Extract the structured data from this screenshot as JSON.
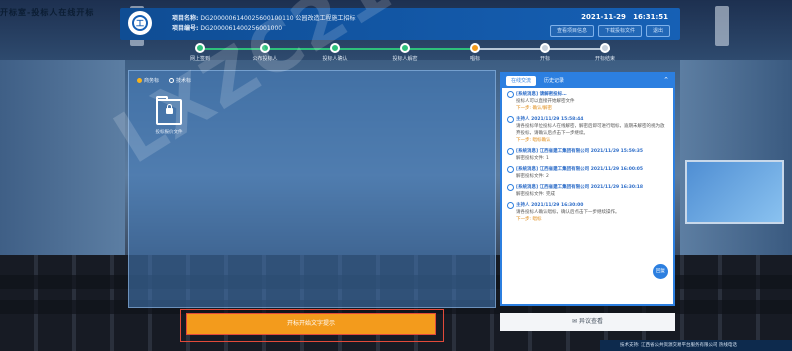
{
  "page_title": "开标室-投标人在线开标",
  "header": {
    "project_name_label": "项目名称:",
    "project_name": "DG2000006140025600100110 公园改造工程施工招标",
    "project_code_label": "项目编号:",
    "project_code": "DG2000061400256001000",
    "date": "2021-11-29",
    "time": "16:31:51",
    "buttons": [
      "查看项目信息",
      "下载投标文件",
      "退出"
    ]
  },
  "steps": [
    {
      "label": "网上签到",
      "state": "done"
    },
    {
      "label": "公布投标人",
      "state": "done"
    },
    {
      "label": "投标人确认",
      "state": "done"
    },
    {
      "label": "投标人解密",
      "state": "done"
    },
    {
      "label": "唱标",
      "state": "current"
    },
    {
      "label": "开标",
      "state": "todo"
    },
    {
      "label": "开标结束",
      "state": "todo"
    }
  ],
  "file_panel": {
    "radio_options": [
      {
        "label": "商务标",
        "selected": true
      },
      {
        "label": "技术标",
        "selected": false
      }
    ],
    "file_name": "投标报价文件"
  },
  "chat": {
    "tabs": [
      {
        "label": "在线交流",
        "active": true
      },
      {
        "label": "历史记录",
        "active": false
      }
    ],
    "messages": [
      {
        "title": "[系统消息] 请解密投标…",
        "text": "投标人可以直接开始解密文件",
        "link": "下一步: 确认/解密"
      },
      {
        "title": "主持人 2021/11/29 15:58:44",
        "text": "请各投标单位投标人在线解密，解密后即可进行唱标，逾期未解密的视为放弃投标，请确认后点击下一步继续。",
        "link": "下一步: 唱标确认"
      },
      {
        "title": "[系统消息] 江西省建工集团有限公司 2021/11/29 15:59:35",
        "text": "解密投标文件: 1",
        "link": ""
      },
      {
        "title": "[系统消息] 江西省建工集团有限公司 2021/11/29 16:00:05",
        "text": "解密投标文件: 2",
        "link": ""
      },
      {
        "title": "[系统消息] 江西省建工集团有限公司 2021/11/29 16:30:18",
        "text": "解密投标文件: 完成",
        "link": ""
      },
      {
        "title": "主持人 2021/11/29 16:30:00",
        "text": "请各投标人确认唱标，确认后点击下一步继续操作。",
        "link": "下一步: 唱标"
      }
    ],
    "fab_label": "回复"
  },
  "actions": {
    "start_label": "开标开始文字提示",
    "objection_label": "异议查看"
  },
  "footer_text": "技术支持: 江西省公共资源交易平台服务有限公司 热线电话",
  "watermark": "LXZC21220240131"
}
